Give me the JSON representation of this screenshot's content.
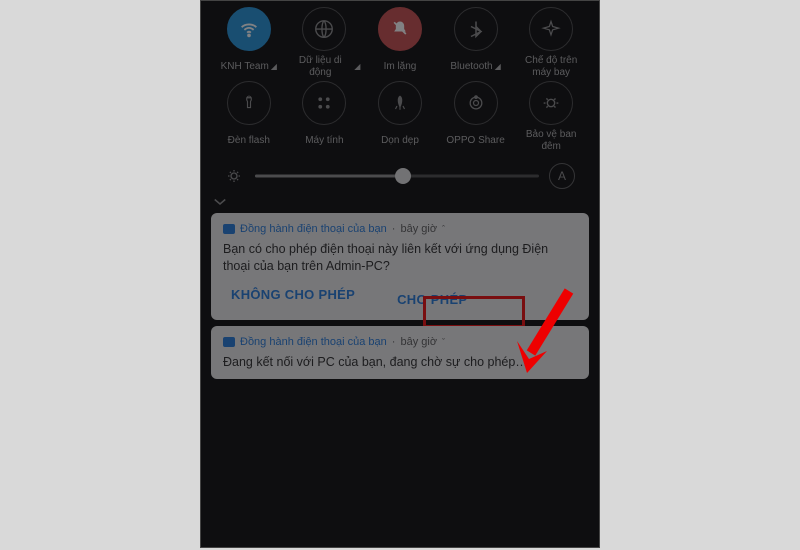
{
  "quick_settings": {
    "row1": [
      {
        "label": "KNH Team",
        "icon": "wifi",
        "active": true,
        "dropdown": true
      },
      {
        "label": "Dữ liệu di động",
        "icon": "globe",
        "active": false,
        "dropdown": true
      },
      {
        "label": "Im lặng",
        "icon": "bell-off",
        "active": true,
        "red": true
      },
      {
        "label": "Bluetooth",
        "icon": "bluetooth",
        "active": false,
        "dropdown": true
      },
      {
        "label": "Chế độ trên máy bay",
        "icon": "airplane",
        "active": false
      }
    ],
    "row2": [
      {
        "label": "Đèn flash",
        "icon": "flashlight",
        "active": false
      },
      {
        "label": "Máy tính",
        "icon": "calculator",
        "active": false
      },
      {
        "label": "Dọn dẹp",
        "icon": "rocket",
        "active": false
      },
      {
        "label": "OPPO Share",
        "icon": "share",
        "active": false
      },
      {
        "label": "Bảo vệ ban đêm",
        "icon": "eye-protect",
        "active": false
      }
    ],
    "brightness_auto": "A"
  },
  "notifications": [
    {
      "app": "Đồng hành điện thoại của bạn",
      "time": "bây giờ",
      "expanded": true,
      "body": "Bạn có cho phép điện thoại này liên kết với ứng dụng Điện thoại của bạn trên Admin-PC?",
      "actions": {
        "deny": "KHÔNG CHO PHÉP",
        "allow": "CHO PHÉP"
      }
    },
    {
      "app": "Đồng hành điện thoại của bạn",
      "time": "bây giờ",
      "expanded": false,
      "body": "Đang kết nối với PC của bạn, đang chờ sự cho phép…"
    }
  ]
}
